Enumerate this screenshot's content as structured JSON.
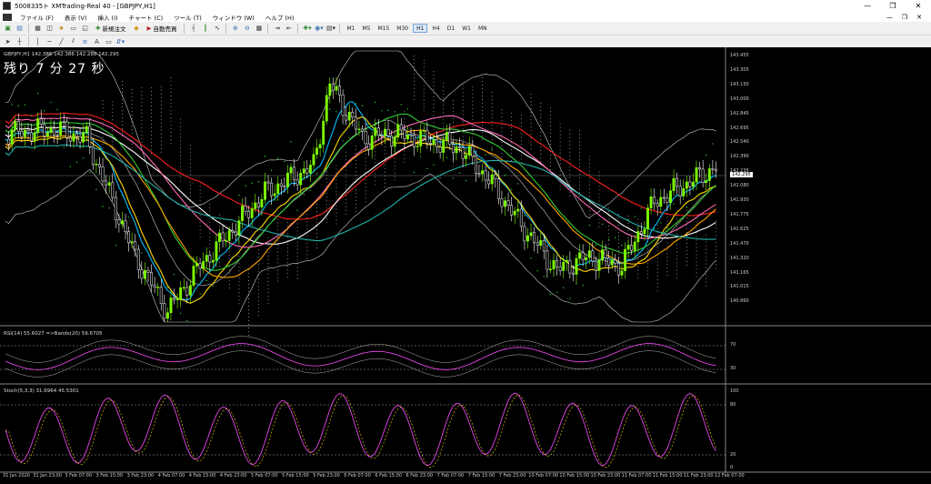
{
  "window": {
    "title": "5008335ト XMTrading-Real 40 - [GBPJPY,H1]",
    "min": "—",
    "max": "❐",
    "close": "✕"
  },
  "menu": [
    "ファイル (F)",
    "表示 (V)",
    "挿入 (I)",
    "チャート (C)",
    "ツール (T)",
    "ウィンドウ (W)",
    "ヘルプ (H)"
  ],
  "toolbar": {
    "new_order": "新規注文",
    "auto_trade": "自動売買",
    "timeframes": [
      "M1",
      "M5",
      "M15",
      "M30",
      "H1",
      "H4",
      "D1",
      "W1",
      "MN"
    ],
    "active_timeframe": "H1"
  },
  "chart": {
    "symbol_header": "GBPJPY,H1  142.386 142.386 142.288 142.295",
    "countdown": "残り 7 分 27 秒",
    "current_price": "142.295",
    "price_axis": [
      "143.455",
      "143.305",
      "143.150",
      "143.000",
      "142.845",
      "142.695",
      "142.540",
      "142.390",
      "142.235",
      "142.080",
      "141.930",
      "141.775",
      "141.625",
      "141.470",
      "141.320",
      "141.165",
      "141.015",
      "140.860"
    ],
    "rsi_label": "RSI(14) 55.6027  =>Bands(20) 59.6705",
    "rsi_axis": [
      "70",
      "30"
    ],
    "stoch_label": "Stoch(5,3,3) 31.6964 45.5301",
    "stoch_axis": [
      "100",
      "80",
      "20",
      "0"
    ],
    "time_axis": [
      "31 Jan 2020",
      "31 Jan 23:00",
      "3 Feb 07:00",
      "3 Feb 15:00",
      "3 Feb 23:00",
      "4 Feb 07:00",
      "4 Feb 15:00",
      "4 Feb 23:00",
      "5 Feb 07:00",
      "5 Feb 15:00",
      "5 Feb 23:00",
      "6 Feb 07:00",
      "6 Feb 15:00",
      "6 Feb 23:00",
      "7 Feb 07:00",
      "7 Feb 15:00",
      "7 Feb 23:00",
      "10 Feb 07:00",
      "10 Feb 15:00",
      "10 Feb 23:00",
      "11 Feb 07:00",
      "11 Feb 15:00",
      "11 Feb 23:00",
      "12 Feb 07:00"
    ],
    "colors": {
      "bull": "#7CFC00",
      "bear": "#ffffff",
      "ma_red": "#ff2020",
      "ma_white": "#ffffff",
      "ma_cyan": "#00bfff",
      "ma_yellow": "#ffd700",
      "ma_green": "#32cd32",
      "ma_magenta": "#ff69b4",
      "ma_orange": "#ffa500",
      "cloud": "#ffffff",
      "rsi": "#ff4dff",
      "stoch": "#ff4dff"
    }
  }
}
